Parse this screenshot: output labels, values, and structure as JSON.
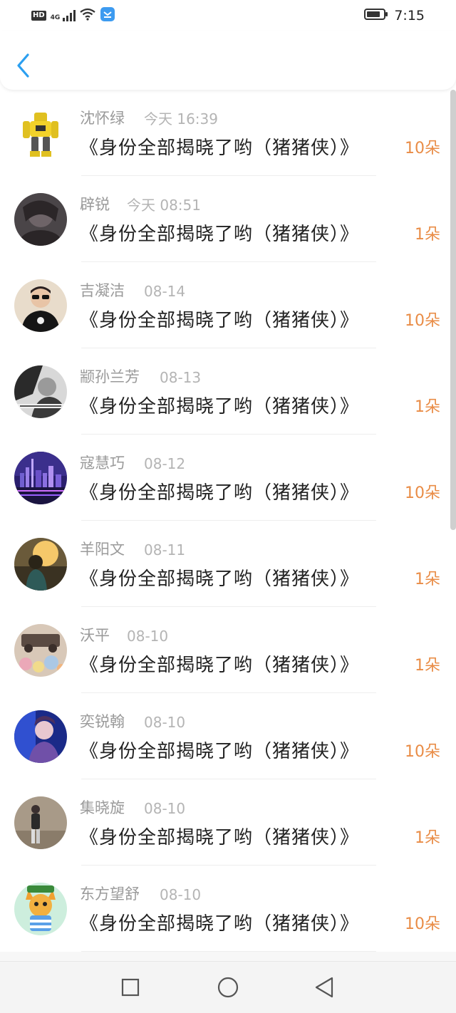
{
  "status_bar": {
    "hd": "HD",
    "network": "4G",
    "time": "7:15"
  },
  "colors": {
    "accent_blue": "#2b9ff0",
    "flower_orange": "#e98c46",
    "name_gray": "#9a9a9a",
    "date_gray": "#b4b4b4",
    "title_black": "#222222"
  },
  "list": {
    "items": [
      {
        "name": "沈怀绿",
        "date": "今天 16:39",
        "title": "《身份全部揭晓了哟（猪猪侠）》",
        "flowers": "10朵",
        "avatar": "robot-avatar"
      },
      {
        "name": "辟锐",
        "date": "今天 08:51",
        "title": "《身份全部揭晓了哟（猪猪侠）》",
        "flowers": "1朵",
        "avatar": "dark-portrait-avatar"
      },
      {
        "name": "吉凝洁",
        "date": "08-14",
        "title": "《身份全部揭晓了哟（猪猪侠）》",
        "flowers": "10朵",
        "avatar": "sunglasses-avatar"
      },
      {
        "name": "颛孙兰芳",
        "date": "08-13",
        "title": "《身份全部揭晓了哟（猪猪侠）》",
        "flowers": "1朵",
        "avatar": "bw-photo-avatar"
      },
      {
        "name": "寇慧巧",
        "date": "08-12",
        "title": "《身份全部揭晓了哟（猪猪侠）》",
        "flowers": "10朵",
        "avatar": "city-night-avatar"
      },
      {
        "name": "羊阳文",
        "date": "08-11",
        "title": "《身份全部揭晓了哟（猪猪侠）》",
        "flowers": "1朵",
        "avatar": "sunset-avatar"
      },
      {
        "name": "沃平",
        "date": "08-10",
        "title": "《身份全部揭晓了哟（猪猪侠）》",
        "flowers": "1朵",
        "avatar": "bokeh-car-avatar"
      },
      {
        "name": "奕锐翰",
        "date": "08-10",
        "title": "《身份全部揭晓了哟（猪猪侠）》",
        "flowers": "10朵",
        "avatar": "blue-portrait-avatar"
      },
      {
        "name": "集晓旋",
        "date": "08-10",
        "title": "《身份全部揭晓了哟（猪猪侠）》",
        "flowers": "1朵",
        "avatar": "walking-person-avatar"
      },
      {
        "name": "东方望舒",
        "date": "08-10",
        "title": "《身份全部揭晓了哟（猪猪侠）》",
        "flowers": "10朵",
        "avatar": "cartoon-cat-avatar"
      }
    ]
  },
  "nav_bar": {
    "buttons": [
      "recent-apps-icon",
      "home-icon",
      "back-icon"
    ]
  }
}
